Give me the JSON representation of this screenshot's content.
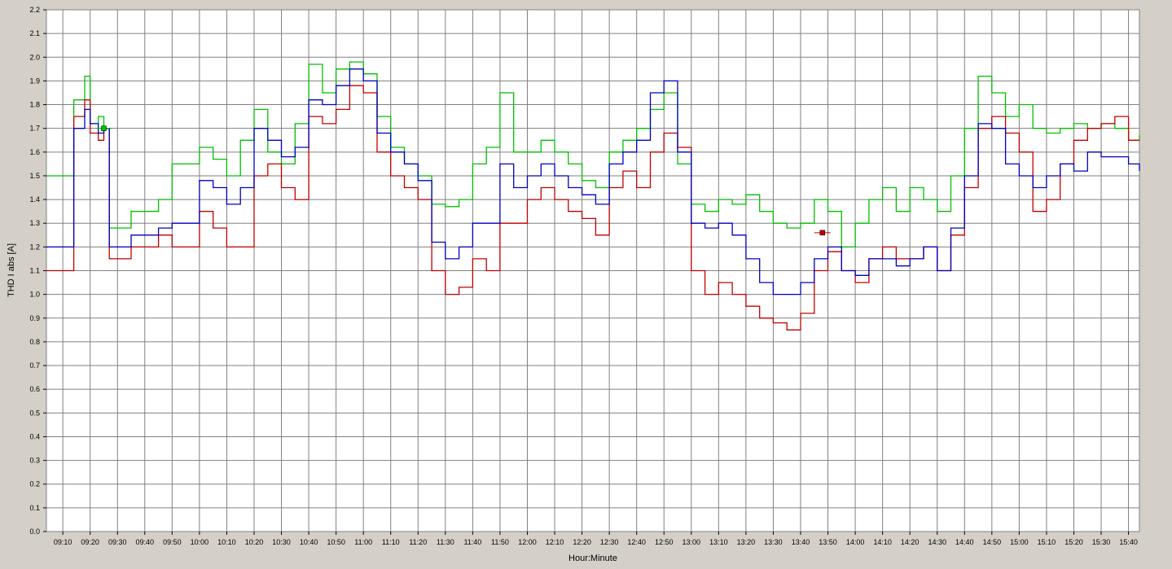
{
  "chart_data": {
    "type": "line",
    "step": true,
    "xlabel": "Hour:Minute",
    "ylabel": "THD I abs [A]",
    "ylim": [
      0,
      2.2
    ],
    "yticks": [
      "0.0",
      "0.1",
      "0.2",
      "0.3",
      "0.4",
      "0.5",
      "0.6",
      "0.7",
      "0.8",
      "0.9",
      "1.0",
      "1.1",
      "1.2",
      "1.3",
      "1.4",
      "1.5",
      "1.6",
      "1.7",
      "1.8",
      "1.9",
      "2.0",
      "2.1",
      "2.2"
    ],
    "xlim": [
      "09:04",
      "15:44"
    ],
    "xticks": [
      "09:10",
      "09:20",
      "09:30",
      "09:40",
      "09:50",
      "10:00",
      "10:10",
      "10:20",
      "10:30",
      "10:40",
      "10:50",
      "11:00",
      "11:10",
      "11:20",
      "11:30",
      "11:40",
      "11:50",
      "12:00",
      "12:10",
      "12:20",
      "12:30",
      "12:40",
      "12:50",
      "13:00",
      "13:10",
      "13:20",
      "13:30",
      "13:40",
      "13:50",
      "14:00",
      "14:10",
      "14:20",
      "14:30",
      "14:40",
      "14:50",
      "15:00",
      "15:10",
      "15:20",
      "15:30",
      "15:40"
    ],
    "grid": true,
    "colors": {
      "background": "#ffffff",
      "grid": "#808080",
      "frame": "#d4d0c8"
    },
    "x": [
      "09:04",
      "09:14",
      "09:18",
      "09:20",
      "09:23",
      "09:25",
      "09:27",
      "09:35",
      "09:45",
      "09:50",
      "10:00",
      "10:05",
      "10:10",
      "10:15",
      "10:20",
      "10:25",
      "10:30",
      "10:35",
      "10:40",
      "10:45",
      "10:50",
      "10:55",
      "11:00",
      "11:05",
      "11:10",
      "11:15",
      "11:20",
      "11:25",
      "11:30",
      "11:35",
      "11:40",
      "11:45",
      "11:50",
      "11:55",
      "12:00",
      "12:05",
      "12:10",
      "12:15",
      "12:20",
      "12:25",
      "12:30",
      "12:35",
      "12:40",
      "12:45",
      "12:50",
      "12:55",
      "13:00",
      "13:05",
      "13:10",
      "13:15",
      "13:20",
      "13:25",
      "13:30",
      "13:35",
      "13:40",
      "13:45",
      "13:50",
      "13:55",
      "14:00",
      "14:05",
      "14:10",
      "14:15",
      "14:20",
      "14:25",
      "14:30",
      "14:35",
      "14:40",
      "14:45",
      "14:50",
      "14:55",
      "15:00",
      "15:05",
      "15:10",
      "15:15",
      "15:20",
      "15:25",
      "15:30",
      "15:35",
      "15:40",
      "15:44"
    ],
    "series": [
      {
        "color": "#00c000",
        "values": [
          1.5,
          1.82,
          1.92,
          1.72,
          1.75,
          1.7,
          1.28,
          1.35,
          1.4,
          1.55,
          1.62,
          1.57,
          1.5,
          1.65,
          1.78,
          1.6,
          1.55,
          1.72,
          1.97,
          1.85,
          1.95,
          1.98,
          1.93,
          1.75,
          1.62,
          1.55,
          1.5,
          1.38,
          1.37,
          1.4,
          1.55,
          1.62,
          1.85,
          1.6,
          1.6,
          1.65,
          1.6,
          1.55,
          1.48,
          1.45,
          1.6,
          1.65,
          1.7,
          1.78,
          1.85,
          1.55,
          1.38,
          1.35,
          1.4,
          1.38,
          1.42,
          1.35,
          1.3,
          1.28,
          1.3,
          1.4,
          1.35,
          1.2,
          1.3,
          1.4,
          1.45,
          1.35,
          1.45,
          1.4,
          1.35,
          1.5,
          1.7,
          1.92,
          1.85,
          1.75,
          1.8,
          1.7,
          1.68,
          1.7,
          1.72,
          1.7,
          1.72,
          1.7,
          1.65,
          1.67
        ]
      },
      {
        "color": "#c00000",
        "values": [
          1.1,
          1.75,
          1.82,
          1.68,
          1.65,
          1.7,
          1.15,
          1.2,
          1.25,
          1.2,
          1.35,
          1.28,
          1.2,
          1.2,
          1.5,
          1.55,
          1.45,
          1.4,
          1.75,
          1.72,
          1.78,
          1.88,
          1.85,
          1.6,
          1.5,
          1.45,
          1.4,
          1.1,
          1.0,
          1.03,
          1.15,
          1.1,
          1.3,
          1.3,
          1.4,
          1.45,
          1.4,
          1.35,
          1.32,
          1.25,
          1.45,
          1.52,
          1.45,
          1.6,
          1.68,
          1.62,
          1.1,
          1.0,
          1.05,
          1.0,
          0.95,
          0.9,
          0.88,
          0.85,
          0.92,
          1.1,
          1.18,
          1.1,
          1.05,
          1.15,
          1.2,
          1.15,
          1.15,
          1.2,
          1.1,
          1.25,
          1.45,
          1.7,
          1.75,
          1.68,
          1.6,
          1.35,
          1.4,
          1.55,
          1.65,
          1.7,
          1.72,
          1.75,
          1.65,
          1.65
        ]
      },
      {
        "color": "#0000c0",
        "values": [
          1.2,
          1.7,
          1.78,
          1.72,
          1.68,
          1.7,
          1.2,
          1.25,
          1.28,
          1.3,
          1.48,
          1.45,
          1.38,
          1.45,
          1.7,
          1.65,
          1.58,
          1.62,
          1.82,
          1.8,
          1.88,
          1.95,
          1.9,
          1.68,
          1.6,
          1.55,
          1.48,
          1.22,
          1.15,
          1.2,
          1.3,
          1.3,
          1.55,
          1.45,
          1.5,
          1.55,
          1.5,
          1.45,
          1.42,
          1.38,
          1.55,
          1.6,
          1.65,
          1.85,
          1.9,
          1.6,
          1.3,
          1.28,
          1.3,
          1.25,
          1.15,
          1.05,
          1.0,
          1.0,
          1.05,
          1.15,
          1.2,
          1.1,
          1.08,
          1.15,
          1.15,
          1.12,
          1.15,
          1.2,
          1.1,
          1.28,
          1.5,
          1.72,
          1.7,
          1.55,
          1.5,
          1.45,
          1.5,
          1.55,
          1.52,
          1.6,
          1.58,
          1.58,
          1.55,
          1.52
        ]
      }
    ],
    "markers": [
      {
        "series": 0,
        "x": "09:25",
        "y": 1.7
      },
      {
        "series": 1,
        "x": "13:48",
        "y": 1.26
      }
    ]
  }
}
